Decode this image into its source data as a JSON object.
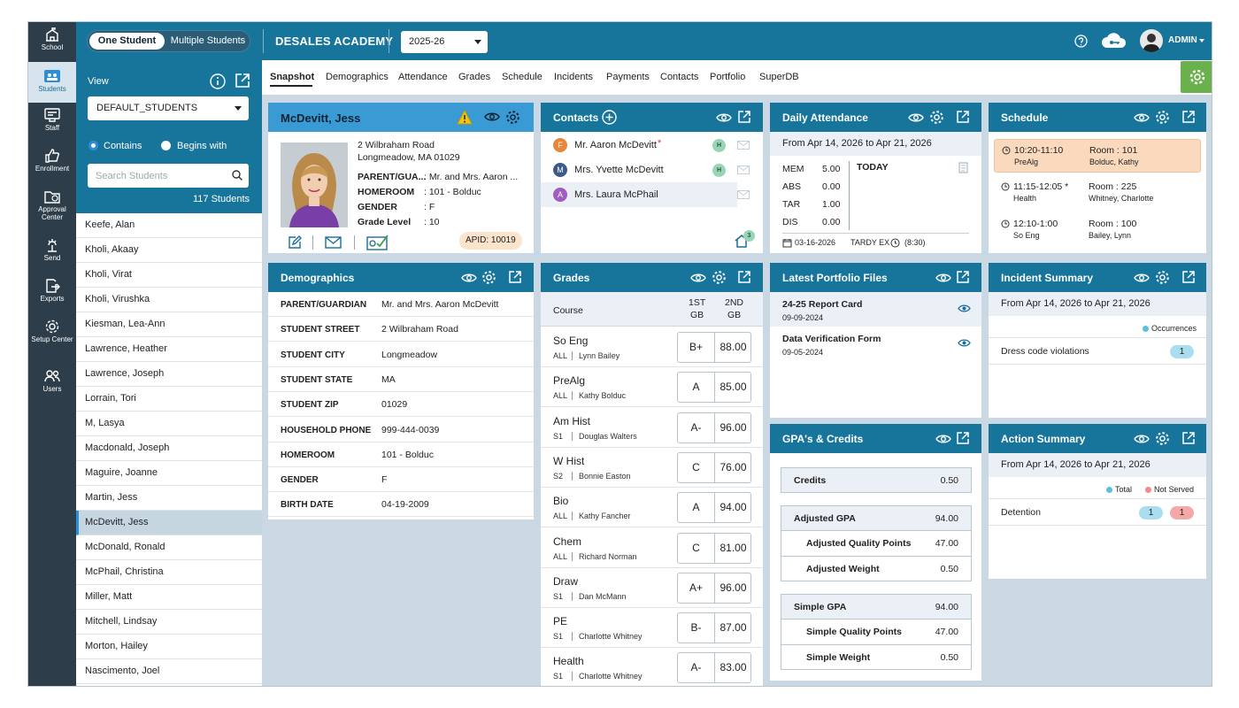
{
  "nav": [
    {
      "label": "School",
      "icon": "school-icon"
    },
    {
      "label": "Students",
      "icon": "students-icon"
    },
    {
      "label": "Staff",
      "icon": "staff-icon"
    },
    {
      "label": "Enrollment",
      "icon": "enrollment-icon"
    },
    {
      "label": "Approval Center",
      "icon": "approval-center-icon"
    },
    {
      "label": "Send",
      "icon": "send-icon"
    },
    {
      "label": "Exports",
      "icon": "exports-icon"
    },
    {
      "label": "Setup Center",
      "icon": "setup-center-icon"
    },
    {
      "label": "Users",
      "icon": "users-icon"
    }
  ],
  "topbar": {
    "one_student": "One Student",
    "multiple_students": "Multiple Students",
    "school": "DESALES ACADEMY",
    "year": "2025-26",
    "user": "ADMIN",
    "accent": "#17759c"
  },
  "student_panel": {
    "view_label": "View",
    "view_value": "DEFAULT_STUDENTS",
    "contains": "Contains",
    "begins_with": "Begins with",
    "search_placeholder": "Search Students",
    "count": "117 Students",
    "students": [
      "Keefe, Alan",
      "Kholi, Akaay",
      "Kholi, Virat",
      "Kholi, Virushka",
      "Kiesman, Lea-Ann",
      "Lawrence, Heather",
      "Lawrence, Joseph",
      "Lorrain, Tori",
      "M, Lasya",
      "Macdonald, Joseph",
      "Maguire, Joanne",
      "Martin, Jess",
      "McDevitt, Jess",
      "McDonald, Ronald",
      "McPhail, Christina",
      "Miller, Matt",
      "Mitchell, Lindsay",
      "Morton, Hailey",
      "Nascimento, Joel"
    ],
    "selected": "McDevitt, Jess"
  },
  "tabs": [
    "Snapshot",
    "Demographics",
    "Attendance",
    "Grades",
    "Schedule",
    "Incidents",
    "Payments",
    "Contacts",
    "Portfolio",
    "SuperDB"
  ],
  "profile": {
    "name": "McDevitt, Jess",
    "address1": "2 Wilbraham Road",
    "address2": "Longmeadow, MA 01029",
    "rows": [
      {
        "label": "PARENT/GUA...",
        "value": ": Mr. and Mrs. Aaron ..."
      },
      {
        "label": "HOMEROOM",
        "value": ": 101 - Bolduc"
      },
      {
        "label": "GENDER",
        "value": ": F"
      },
      {
        "label": "Grade Level",
        "value": ": 10"
      }
    ],
    "apid": "APID:  10019"
  },
  "demographics": {
    "title": "Demographics",
    "rows": [
      {
        "label": "PARENT/GUARDIAN",
        "value": "Mr. and Mrs. Aaron McDevitt"
      },
      {
        "label": "STUDENT STREET",
        "value": "2 Wilbraham Road"
      },
      {
        "label": "STUDENT CITY",
        "value": "Longmeadow"
      },
      {
        "label": "STUDENT STATE",
        "value": "MA"
      },
      {
        "label": "STUDENT ZIP",
        "value": "01029"
      },
      {
        "label": "HOUSEHOLD PHONE",
        "value": "999-444-0039"
      },
      {
        "label": "HOMEROOM",
        "value": "101 - Bolduc"
      },
      {
        "label": "GENDER",
        "value": "F"
      },
      {
        "label": "BIRTH DATE",
        "value": "04-19-2009"
      }
    ]
  },
  "contacts": {
    "title": "Contacts",
    "items": [
      {
        "initial": "F",
        "name": "Mr. Aaron McDevitt",
        "star": "*",
        "h": "H",
        "color": "#e8873a"
      },
      {
        "initial": "M",
        "name": "Mrs. Yvette McDevitt",
        "star": "",
        "h": "H",
        "color": "#3d5a8a"
      },
      {
        "initial": "A",
        "name": "Mrs. Laura McPhail",
        "star": "",
        "h": "",
        "color": "#a25bbf"
      }
    ],
    "home_count": "3"
  },
  "grades": {
    "title": "Grades",
    "col_course": "Course",
    "col_1": "1ST GB",
    "col_1a": "1ST",
    "col_1b": "GB",
    "col_2a": "2ND",
    "col_2b": "GB",
    "rows": [
      {
        "course": "So Eng",
        "term": "ALL",
        "teacher": "Lynn Bailey",
        "grade": "B+",
        "score": "88.00"
      },
      {
        "course": "PreAlg",
        "term": "ALL",
        "teacher": "Kathy Bolduc",
        "grade": "A",
        "score": "85.00"
      },
      {
        "course": "Am Hist",
        "term": "S1",
        "teacher": "Douglas Walters",
        "grade": "A-",
        "score": "96.00"
      },
      {
        "course": "W Hist",
        "term": "S2",
        "teacher": "Bonnie Easton",
        "grade": "C",
        "score": "76.00"
      },
      {
        "course": "Bio",
        "term": "ALL",
        "teacher": "Kathy Fancher",
        "grade": "A",
        "score": "94.00"
      },
      {
        "course": "Chem",
        "term": "ALL",
        "teacher": "Richard Norman",
        "grade": "C",
        "score": "81.00"
      },
      {
        "course": "Draw",
        "term": "S1",
        "teacher": "Dan McMann",
        "grade": "A+",
        "score": "96.00"
      },
      {
        "course": "PE",
        "term": "S1",
        "teacher": "Charlotte Whitney",
        "grade": "B-",
        "score": "87.00"
      },
      {
        "course": "Health",
        "term": "S1",
        "teacher": "Charlotte Whitney",
        "grade": "A-",
        "score": "83.00"
      }
    ]
  },
  "attendance": {
    "title": "Daily Attendance",
    "range": "From Apr 14, 2026 to Apr 21, 2026",
    "stats": [
      {
        "label": "MEM",
        "value": "5.00"
      },
      {
        "label": "ABS",
        "value": "0.00"
      },
      {
        "label": "TAR",
        "value": "1.00"
      },
      {
        "label": "DIS",
        "value": "0.00"
      }
    ],
    "today": "TODAY",
    "date": "03-16-2026",
    "tardy": "TARDY EX",
    "time": "(8:30)"
  },
  "portfolio": {
    "title": "Latest Portfolio Files",
    "files": [
      {
        "name": "24-25 Report Card",
        "date": "09-09-2024"
      },
      {
        "name": "Data Verification Form",
        "date": "09-05-2024"
      }
    ]
  },
  "gpa": {
    "title": "GPA's & Credits",
    "credits_label": "Credits",
    "credits": "0.50",
    "adj_gpa_label": "Adjusted GPA",
    "adj_gpa": "94.00",
    "adj_qp_label": "Adjusted Quality Points",
    "adj_qp": "47.00",
    "adj_w_label": "Adjusted Weight",
    "adj_w": "0.50",
    "simple_gpa_label": "Simple GPA",
    "simple_gpa": "94.00",
    "simple_qp_label": "Simple Quality Points",
    "simple_qp": "47.00",
    "simple_w_label": "Simple Weight",
    "simple_w": "0.50"
  },
  "schedule": {
    "title": "Schedule",
    "items": [
      {
        "time": "10:20-11:10",
        "course": "PreAlg",
        "room": "Room : 101",
        "teacher": "Bolduc, Kathy",
        "current": true
      },
      {
        "time": "11:15-12:05 *",
        "course": "Health",
        "room": "Room : 225",
        "teacher": "Whitney, Charlotte",
        "current": false
      },
      {
        "time": "12:10-1:00",
        "course": "So Eng",
        "room": "Room : 100",
        "teacher": "Bailey, Lynn",
        "current": false
      }
    ]
  },
  "incidents": {
    "title": "Incident Summary",
    "range": "From Apr 14, 2026 to Apr 21, 2026",
    "legend": "Occurrences",
    "rows": [
      {
        "label": "Dress code violations",
        "count": "1"
      }
    ]
  },
  "actions": {
    "title": "Action Summary",
    "range": "From Apr 14, 2026 to Apr 21, 2026",
    "legend_total": "Total",
    "legend_not_served": "Not Served",
    "rows": [
      {
        "label": "Detention",
        "total": "1",
        "not_served": "1"
      }
    ]
  }
}
